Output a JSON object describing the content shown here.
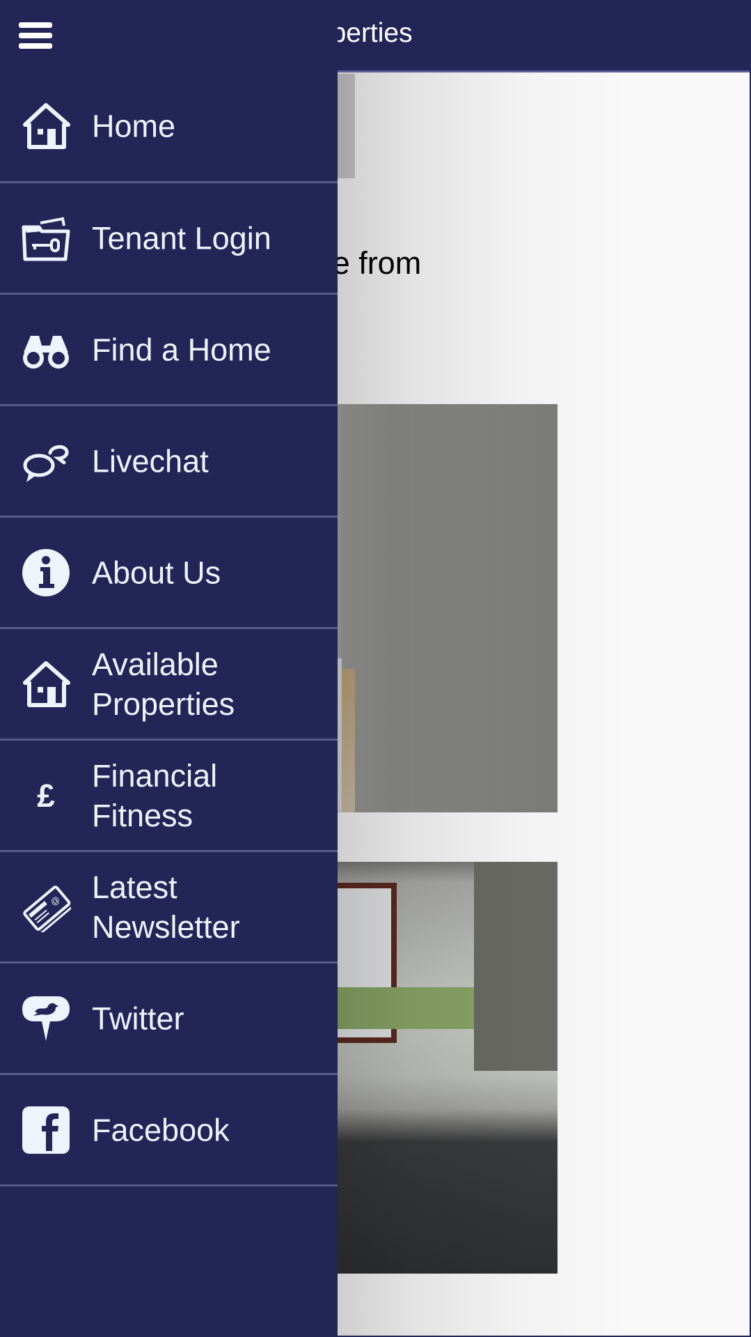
{
  "page": {
    "title": "Available Properties",
    "visible_title_fragment": "ble Properties",
    "listing_title_fragment": "oor Flat available from",
    "photos": [
      {
        "alt": "Room with radiator and textured wall"
      },
      {
        "alt": "Room with window and dark carpet"
      }
    ]
  },
  "drawer": {
    "menu_button_icon": "hamburger-icon",
    "items": [
      {
        "label": "Home",
        "icon": "house-icon"
      },
      {
        "label": "Tenant Login",
        "icon": "key-folder-icon"
      },
      {
        "label": "Find a Home",
        "icon": "binoculars-icon"
      },
      {
        "label": "Livechat",
        "icon": "chat-bubbles-icon"
      },
      {
        "label": "About Us",
        "icon": "info-icon"
      },
      {
        "label": "Available\nProperties",
        "icon": "house-icon"
      },
      {
        "label": "Financial\nFitness",
        "icon": "pound-icon"
      },
      {
        "label": "Latest\nNewsletter",
        "icon": "newsletter-icon"
      },
      {
        "label": "Twitter",
        "icon": "twitter-icon"
      },
      {
        "label": "Facebook",
        "icon": "facebook-icon"
      }
    ]
  },
  "colors": {
    "brand_navy": "#232557",
    "divider": "#575a8c",
    "menu_text": "#eef4fb",
    "page_bg": "#f9f9fa"
  }
}
